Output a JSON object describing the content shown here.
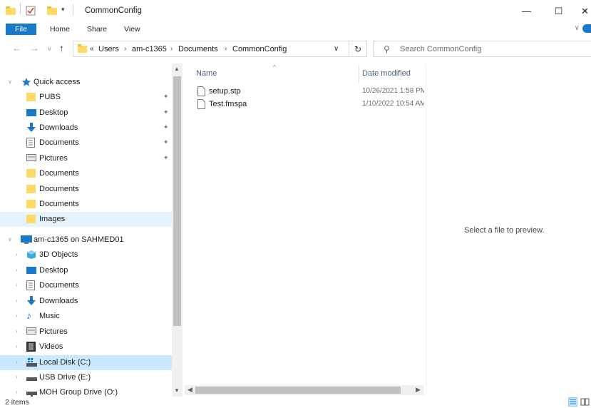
{
  "window": {
    "title": "CommonConfig",
    "minimize_glyph": "—",
    "maximize_glyph": "☐",
    "close_glyph": "✕"
  },
  "ribbon": {
    "file_label": "File",
    "tabs": [
      "Home",
      "Share",
      "View"
    ]
  },
  "address": {
    "overflow_glyph": "«",
    "crumbs": [
      "Users",
      "am-c1365",
      "Documents",
      "CommonConfig"
    ]
  },
  "search": {
    "placeholder": "Search CommonConfig"
  },
  "nav": {
    "quick_access_label": "Quick access",
    "quick_access_items": [
      {
        "label": "PUBS",
        "icon": "folder-yellow-icon",
        "pinned": true
      },
      {
        "label": "Desktop",
        "icon": "desktop-icon",
        "pinned": true
      },
      {
        "label": "Downloads",
        "icon": "download-arrow-icon",
        "pinned": true
      },
      {
        "label": "Documents",
        "icon": "document-icon",
        "pinned": true
      },
      {
        "label": "Pictures",
        "icon": "pictures-icon",
        "pinned": true
      },
      {
        "label": "Documents",
        "icon": "folder-yellow-icon",
        "pinned": false
      },
      {
        "label": "Documents",
        "icon": "folder-yellow-icon",
        "pinned": false
      },
      {
        "label": "Documents",
        "icon": "folder-yellow-icon",
        "pinned": false
      },
      {
        "label": "Images",
        "icon": "folder-yellow-icon",
        "pinned": false
      }
    ],
    "pc_label": "am-c1365 on SAHMED01",
    "pc_items": [
      {
        "label": "3D Objects",
        "icon": "3d-objects-icon"
      },
      {
        "label": "Desktop",
        "icon": "desktop-icon"
      },
      {
        "label": "Documents",
        "icon": "document-icon"
      },
      {
        "label": "Downloads",
        "icon": "download-arrow-icon"
      },
      {
        "label": "Music",
        "icon": "music-note-icon"
      },
      {
        "label": "Pictures",
        "icon": "pictures-icon"
      },
      {
        "label": "Videos",
        "icon": "video-icon"
      },
      {
        "label": "Local Disk (C:)",
        "icon": "windows-drive-icon"
      },
      {
        "label": "USB Drive (E:)",
        "icon": "usb-drive-icon"
      },
      {
        "label": "MOH Group Drive (O:)",
        "icon": "network-drive-icon"
      }
    ]
  },
  "columns": {
    "name": "Name",
    "date_modified": "Date modified"
  },
  "files": [
    {
      "name": "setup.stp",
      "date": "10/26/2021 1:58 PM"
    },
    {
      "name": "Test.fmspa",
      "date": "1/10/2022 10:54 AM"
    }
  ],
  "preview": {
    "message": "Select a file to preview."
  },
  "status": {
    "item_count": "2 items"
  },
  "colors": {
    "accent": "#1979ca",
    "selection": "#cce8ff",
    "folder": "#ffd966",
    "column_header": "#4c607a"
  }
}
